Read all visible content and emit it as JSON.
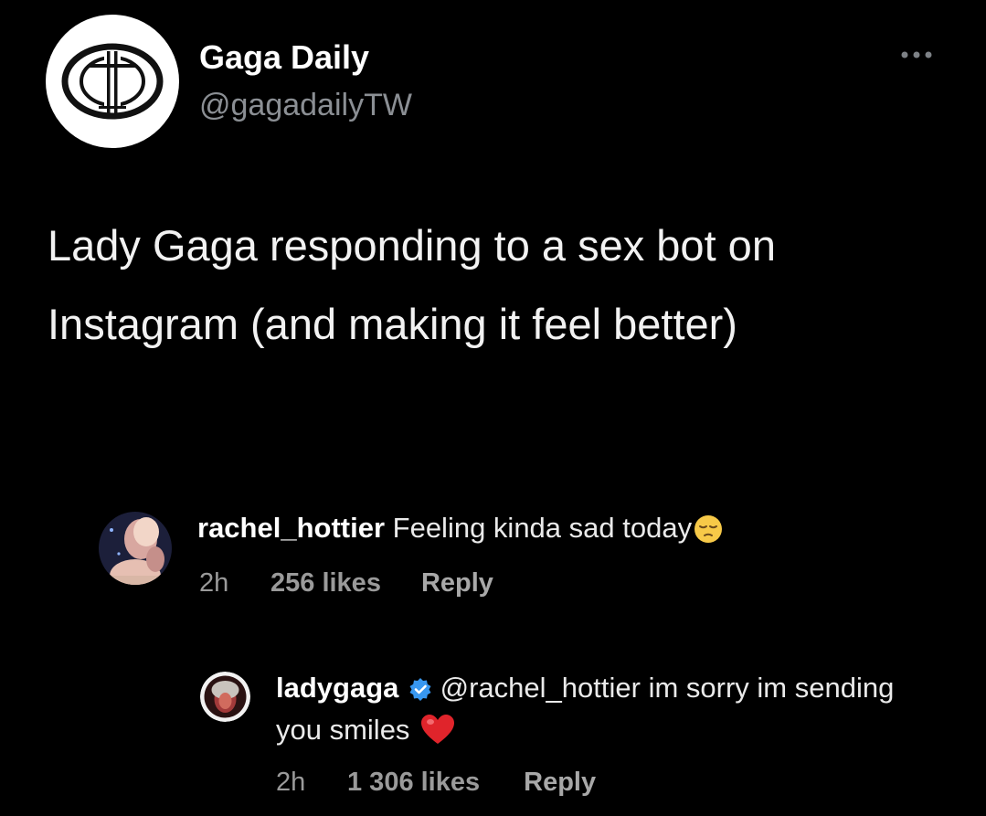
{
  "tweet": {
    "author_name": "Gaga Daily",
    "author_handle": "@gagadailyTW",
    "text": "Lady Gaga responding to a sex bot on Instagram (and making it feel better)",
    "more_icon": "ellipsis-icon",
    "avatar_icon": "gaga-daily-logo-icon"
  },
  "comments": [
    {
      "username": "rachel_hottier",
      "text": "Feeling kinda sad today",
      "emoji": "pensive-face-icon",
      "time": "2h",
      "likes": "256 likes",
      "reply_label": "Reply"
    },
    {
      "username": "ladygaga",
      "verified_icon": "verified-badge-icon",
      "mention": "@rachel_hottier",
      "text": "im sorry im sending you smiles",
      "emoji": "red-heart-icon",
      "time": "2h",
      "likes": "1 306 likes",
      "reply_label": "Reply"
    }
  ],
  "colors": {
    "background": "#000000",
    "text_primary": "#ffffff",
    "text_secondary": "#8b8f94",
    "verified_blue": "#3897f0",
    "heart_red": "#e0242b"
  }
}
